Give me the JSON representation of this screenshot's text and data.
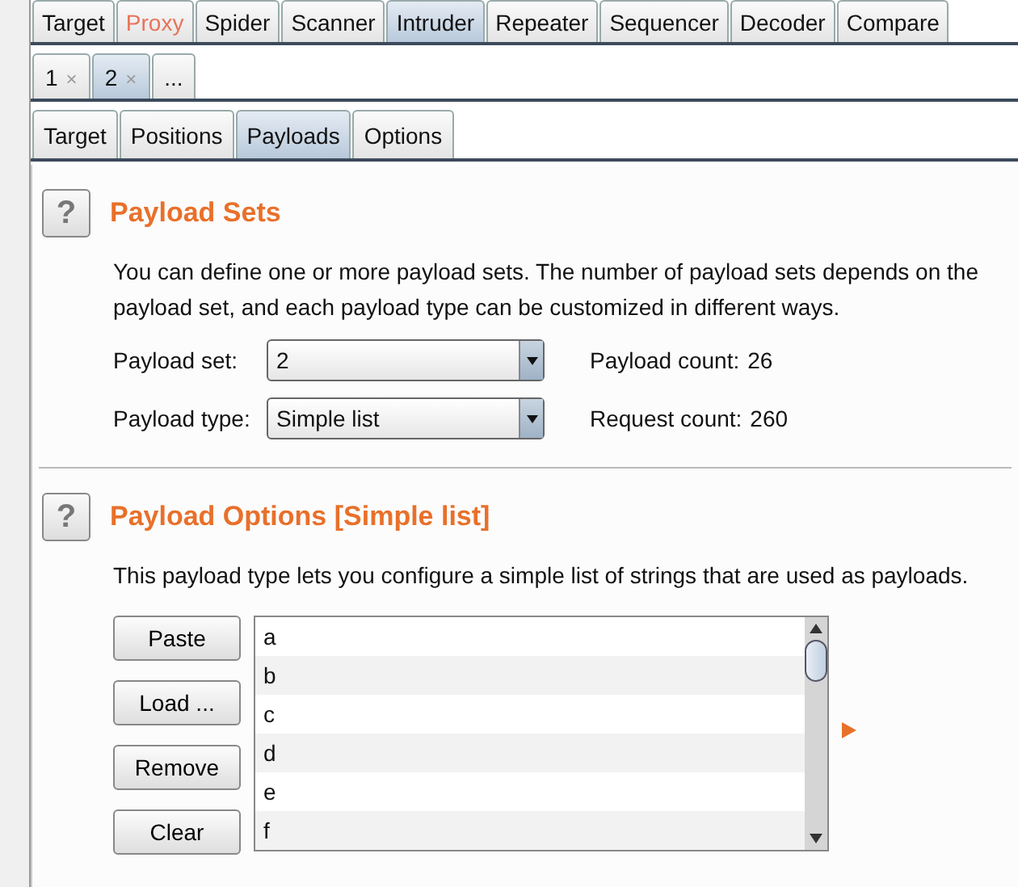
{
  "main_tabs": [
    {
      "label": "Target",
      "selected": false,
      "highlighted": false
    },
    {
      "label": "Proxy",
      "selected": false,
      "highlighted": true
    },
    {
      "label": "Spider",
      "selected": false,
      "highlighted": false
    },
    {
      "label": "Scanner",
      "selected": false,
      "highlighted": false
    },
    {
      "label": "Intruder",
      "selected": true,
      "highlighted": false
    },
    {
      "label": "Repeater",
      "selected": false,
      "highlighted": false
    },
    {
      "label": "Sequencer",
      "selected": false,
      "highlighted": false
    },
    {
      "label": "Decoder",
      "selected": false,
      "highlighted": false
    },
    {
      "label": "Compare",
      "selected": false,
      "highlighted": false
    }
  ],
  "attack_tabs": [
    {
      "label": "1",
      "closable": true,
      "selected": false
    },
    {
      "label": "2",
      "closable": true,
      "selected": true
    },
    {
      "label": "...",
      "closable": false,
      "selected": false
    }
  ],
  "close_glyph": "×",
  "sub_tabs": [
    {
      "label": "Target",
      "selected": false
    },
    {
      "label": "Positions",
      "selected": false
    },
    {
      "label": "Payloads",
      "selected": true
    },
    {
      "label": "Options",
      "selected": false
    }
  ],
  "payload_sets": {
    "help": "?",
    "title": "Payload Sets",
    "description": [
      "You can define one or more payload sets. The number of payload sets depends on the",
      "payload set, and each payload type can be customized in different ways."
    ],
    "fields": [
      {
        "label": "Payload set:",
        "value": "2",
        "info_label": "Payload count:",
        "info_value": "26"
      },
      {
        "label": "Payload type:",
        "value": "Simple list",
        "info_label": "Request count:",
        "info_value": "260"
      }
    ]
  },
  "payload_options": {
    "help": "?",
    "title": "Payload Options [Simple list]",
    "description": "This payload type lets you configure a simple list of strings that are used as payloads.",
    "buttons": [
      "Paste",
      "Load ...",
      "Remove",
      "Clear"
    ],
    "items": [
      "a",
      "b",
      "c",
      "d",
      "e",
      "f"
    ]
  }
}
